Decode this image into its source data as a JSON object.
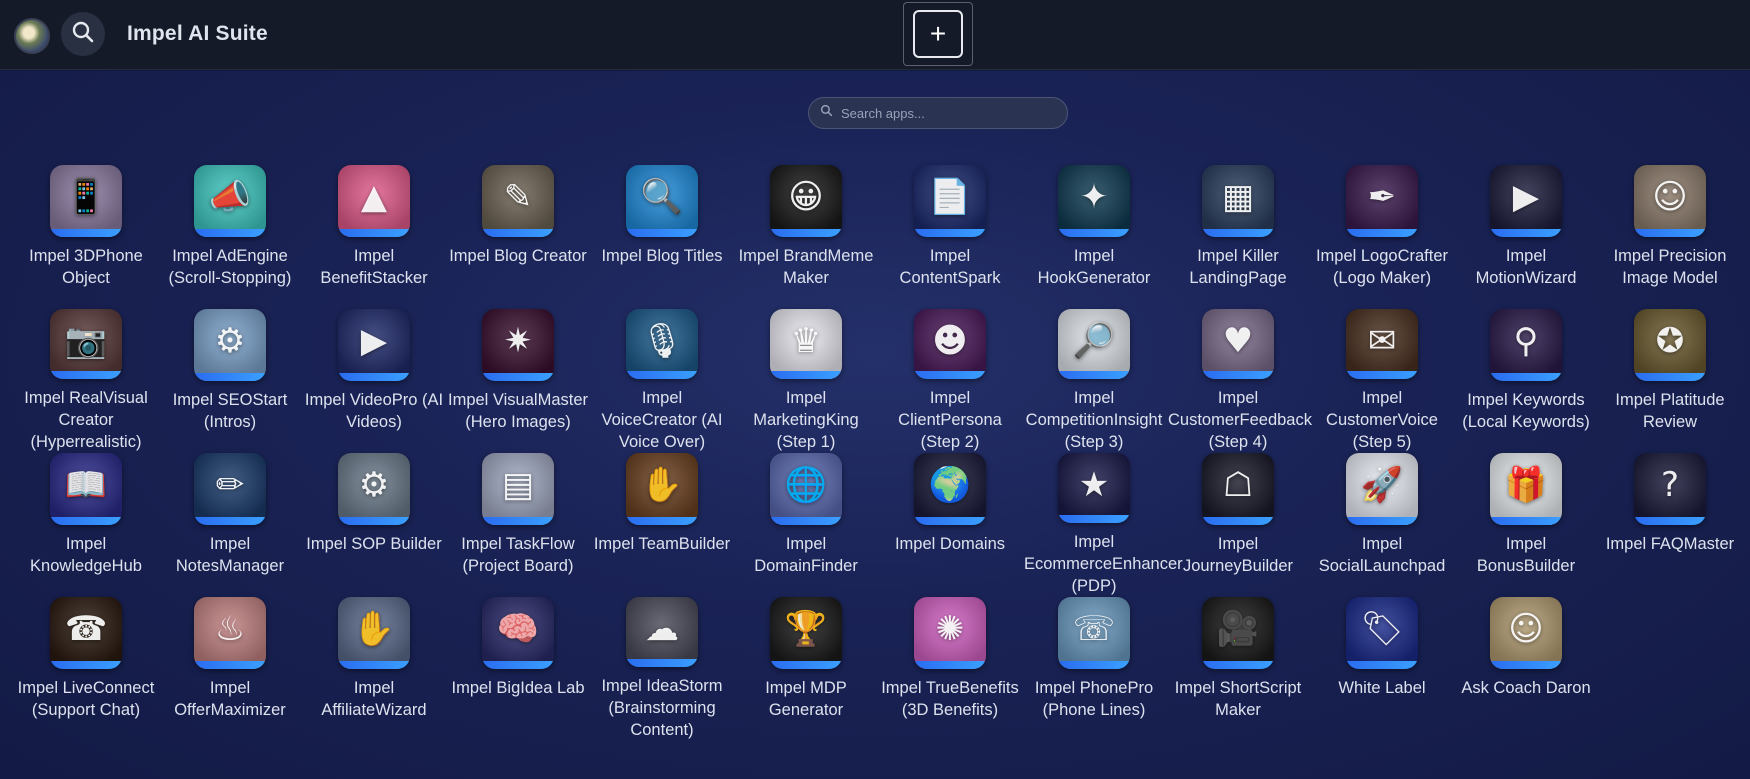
{
  "header": {
    "title": "Impel AI Suite",
    "search_icon": "search-icon",
    "add_label": "+"
  },
  "search": {
    "placeholder": "Search apps..."
  },
  "apps": [
    {
      "label": "Impel 3DPhone Object",
      "glyph": "📱",
      "bg": "#8a7aa0"
    },
    {
      "label": "Impel AdEngine (Scroll-Stopping)",
      "glyph": "📣",
      "bg": "#3fc7c0"
    },
    {
      "label": "Impel BenefitStacker",
      "glyph": "▲",
      "bg": "#e05a8a"
    },
    {
      "label": "Impel Blog Creator",
      "glyph": "✎",
      "bg": "#6b6152"
    },
    {
      "label": "Impel Blog Titles",
      "glyph": "🔍",
      "bg": "#1f8ad8"
    },
    {
      "label": "Impel BrandMeme Maker",
      "glyph": "😀",
      "bg": "#1a1a1a"
    },
    {
      "label": "Impel ContentSpark",
      "glyph": "📄",
      "bg": "#1c2a6e"
    },
    {
      "label": "Impel HookGenerator",
      "glyph": "✦",
      "bg": "#0f3b52"
    },
    {
      "label": "Impel Killer LandingPage",
      "glyph": "▦",
      "bg": "#2a3e5e"
    },
    {
      "label": "Impel LogoCrafter (Logo Maker)",
      "glyph": "✒",
      "bg": "#3a1a4e"
    },
    {
      "label": "Impel MotionWizard",
      "glyph": "▶",
      "bg": "#1c1c3c"
    },
    {
      "label": "Impel Precision Image Model",
      "glyph": "☺",
      "bg": "#8b7a6a"
    },
    {
      "label": "Impel RealVisual Creator (Hyperrealistic)",
      "glyph": "📷",
      "bg": "#5a3a3a"
    },
    {
      "label": "Impel SEOStart (Intros)",
      "glyph": "⚙",
      "bg": "#7aa0c8"
    },
    {
      "label": "Impel VideoPro (AI Videos)",
      "glyph": "▶",
      "bg": "#1f2a6a"
    },
    {
      "label": "Impel VisualMaster (Hero Images)",
      "glyph": "✷",
      "bg": "#3a1030"
    },
    {
      "label": "Impel VoiceCreator (AI Voice Over)",
      "glyph": "🎙",
      "bg": "#1c5a8a"
    },
    {
      "label": "Impel MarketingKing (Step 1)",
      "glyph": "♛",
      "bg": "#e8e8f0"
    },
    {
      "label": "Impel ClientPersona (Step 2)",
      "glyph": "☻",
      "bg": "#4a1a5a"
    },
    {
      "label": "Impel CompetitionInsight (Step 3)",
      "glyph": "🔎",
      "bg": "#dfe4ea"
    },
    {
      "label": "Impel CustomerFeedback (Step 4)",
      "glyph": "♥",
      "bg": "#7a6a8a"
    },
    {
      "label": "Impel CustomerVoice (Step 5)",
      "glyph": "✉",
      "bg": "#4a3020"
    },
    {
      "label": "Impel Keywords (Local Keywords)",
      "glyph": "⚲",
      "bg": "#2a1a4a"
    },
    {
      "label": "Impel Platitude Review",
      "glyph": "✪",
      "bg": "#6a5a30"
    },
    {
      "label": "Impel KnowledgeHub",
      "glyph": "📖",
      "bg": "#2a2a8a"
    },
    {
      "label": "Impel NotesManager",
      "glyph": "✏",
      "bg": "#1a3a6a"
    },
    {
      "label": "Impel SOP Builder",
      "glyph": "⚙",
      "bg": "#6a7a8a"
    },
    {
      "label": "Impel TaskFlow (Project Board)",
      "glyph": "▤",
      "bg": "#a0a8c0"
    },
    {
      "label": "Impel TeamBuilder",
      "glyph": "✋",
      "bg": "#6a4020"
    },
    {
      "label": "Impel DomainFinder",
      "glyph": "🌐",
      "bg": "#5a6ab0"
    },
    {
      "label": "Impel Domains",
      "glyph": "🌍",
      "bg": "#1a1a3a"
    },
    {
      "label": "Impel EcommerceEnhancer (PDP)",
      "glyph": "★",
      "bg": "#1a1a4a"
    },
    {
      "label": "Impel JourneyBuilder",
      "glyph": "☖",
      "bg": "#1a1a2a"
    },
    {
      "label": "Impel SocialLaunchpad",
      "glyph": "🚀",
      "bg": "#e8ecf4"
    },
    {
      "label": "Impel BonusBuilder",
      "glyph": "🎁",
      "bg": "#e8ecf0"
    },
    {
      "label": "Impel FAQMaster",
      "glyph": "?",
      "bg": "#1a1a3a"
    },
    {
      "label": "Impel LiveConnect (Support Chat)",
      "glyph": "☎",
      "bg": "#2a1a10"
    },
    {
      "label": "Impel OfferMaximizer",
      "glyph": "♨",
      "bg": "#c08080"
    },
    {
      "label": "Impel AffiliateWizard",
      "glyph": "✋",
      "bg": "#5a6a8a"
    },
    {
      "label": "Impel BigIdea Lab",
      "glyph": "🧠",
      "bg": "#2a2a6a"
    },
    {
      "label": "Impel IdeaStorm (Brainstorming Content)",
      "glyph": "☁",
      "bg": "#4a4a5a"
    },
    {
      "label": "Impel MDP Generator",
      "glyph": "🏆",
      "bg": "#1a1a1a"
    },
    {
      "label": "Impel TrueBenefits (3D Benefits)",
      "glyph": "✺",
      "bg": "#d060c0"
    },
    {
      "label": "Impel PhonePro (Phone Lines)",
      "glyph": "☏",
      "bg": "#6a9ac0"
    },
    {
      "label": "Impel ShortScript Maker",
      "glyph": "🎥",
      "bg": "#1a1a1a"
    },
    {
      "label": "White Label",
      "glyph": "🏷",
      "bg": "#1a2a8a"
    },
    {
      "label": "Ask Coach Daron",
      "glyph": "☺",
      "bg": "#b09a70"
    }
  ]
}
